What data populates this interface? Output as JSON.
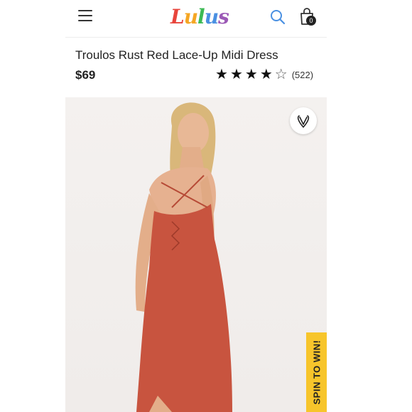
{
  "header": {
    "menu_icon": "hamburger-menu-icon",
    "logo_letters": [
      "L",
      "u",
      "l",
      "u",
      "s"
    ],
    "logo_colors": [
      "#e8453c",
      "#f5a623",
      "#3cba54",
      "#4a90e2",
      "#9b59b6"
    ],
    "search_icon": "search-icon",
    "search_color": "#4a90e2",
    "bag_icon": "shopping-bag-icon",
    "bag_count": "0"
  },
  "product": {
    "title": "Troulos Rust Red Lace-Up Midi Dress",
    "price": "$69",
    "rating_stars": 4,
    "rating_max": 5,
    "rating_count": "(522)"
  },
  "image": {
    "favorite_icon": "heart-outline-icon",
    "dress_color": "#c8543f",
    "promo_label": "SPIN TO WIN!",
    "promo_color": "#f7c52b"
  }
}
